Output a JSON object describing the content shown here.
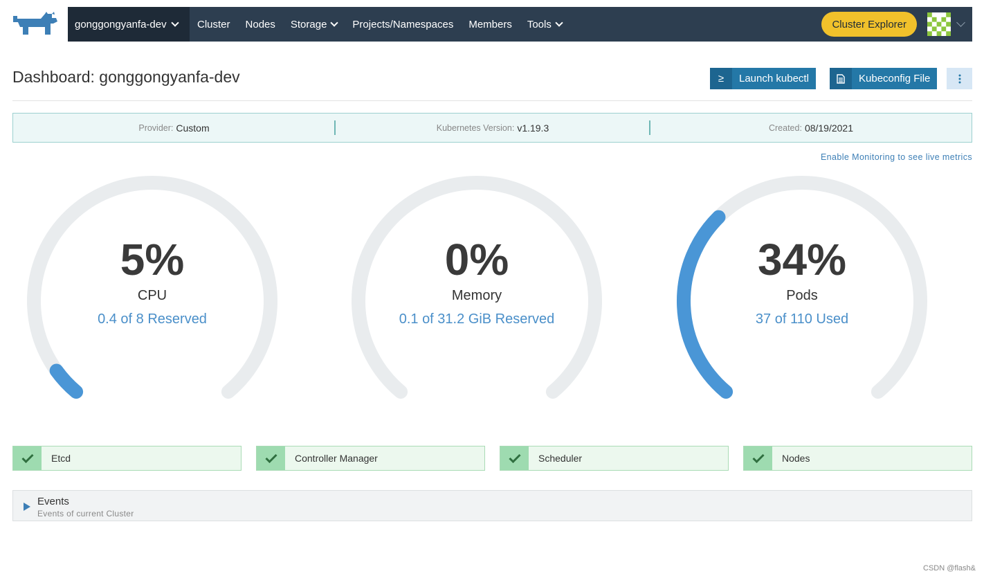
{
  "nav": {
    "cluster_name": "gonggongyanfa-dev",
    "items": [
      {
        "label": "Cluster",
        "dropdown": false
      },
      {
        "label": "Nodes",
        "dropdown": false
      },
      {
        "label": "Storage",
        "dropdown": true
      },
      {
        "label": "Projects/Namespaces",
        "dropdown": false
      },
      {
        "label": "Members",
        "dropdown": false
      },
      {
        "label": "Tools",
        "dropdown": true
      }
    ],
    "explorer_label": "Cluster Explorer"
  },
  "header": {
    "title": "Dashboard: gonggongyanfa-dev",
    "kubectl_icon": "≥",
    "kubectl_label": "Launch kubectl",
    "kubeconfig_label": "Kubeconfig File"
  },
  "info": {
    "provider_key": "Provider:",
    "provider_val": "Custom",
    "k8s_key": "Kubernetes Version:",
    "k8s_val": "v1.19.3",
    "created_key": "Created:",
    "created_val": "08/19/2021"
  },
  "monitoring_link": "Enable Monitoring to see live metrics",
  "gauges": [
    {
      "percent": "5%",
      "fraction": 0.05,
      "name": "CPU",
      "sub": "0.4 of 8 Reserved"
    },
    {
      "percent": "0%",
      "fraction": 0.0,
      "name": "Memory",
      "sub": "0.1 of 31.2 GiB Reserved"
    },
    {
      "percent": "34%",
      "fraction": 0.34,
      "name": "Pods",
      "sub": "37 of 110 Used"
    }
  ],
  "components": [
    {
      "label": "Etcd"
    },
    {
      "label": "Controller Manager"
    },
    {
      "label": "Scheduler"
    },
    {
      "label": "Nodes"
    }
  ],
  "events": {
    "title": "Events",
    "subtitle": "Events of current Cluster"
  },
  "colors": {
    "nav_bg": "#2d3e50",
    "accent_yellow": "#f1c12b",
    "primary_blue": "#2478a7",
    "gauge_fill": "#4a96d6",
    "gauge_track": "#e9ecee",
    "ok_green": "#9edbb0"
  },
  "watermark": "CSDN @flash&"
}
